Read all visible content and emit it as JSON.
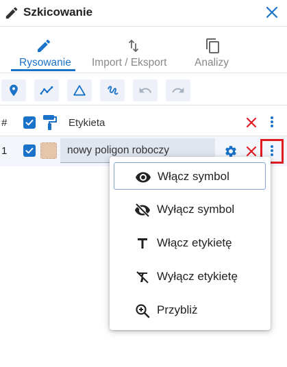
{
  "header": {
    "title": "Szkicowanie"
  },
  "tabs": [
    {
      "label": "Rysowanie",
      "active": true
    },
    {
      "label": "Import / Eksport",
      "active": false
    },
    {
      "label": "Analizy",
      "active": false
    }
  ],
  "toolbar": {
    "tools": [
      "map-marker-icon",
      "polyline-icon",
      "triangle-icon",
      "freehand-icon",
      "undo-icon",
      "redo-icon"
    ]
  },
  "table": {
    "header": {
      "number": "#",
      "column_label": "Etykieta"
    },
    "rows": [
      {
        "number": "1",
        "name": "nowy poligon roboczy"
      }
    ]
  },
  "menu": {
    "items": [
      {
        "label": "Włącz symbol",
        "icon": "eye-icon"
      },
      {
        "label": "Wyłącz symbol",
        "icon": "eye-off-icon"
      },
      {
        "label": "Włącz etykietę",
        "icon": "text-icon"
      },
      {
        "label": "Wyłącz etykietę",
        "icon": "text-off-icon"
      },
      {
        "label": "Przybliż",
        "icon": "zoom-in-icon"
      }
    ]
  },
  "colors": {
    "accent": "#1a73c8",
    "danger": "#e01b24",
    "polygon_fill": "#e6c6aa"
  }
}
